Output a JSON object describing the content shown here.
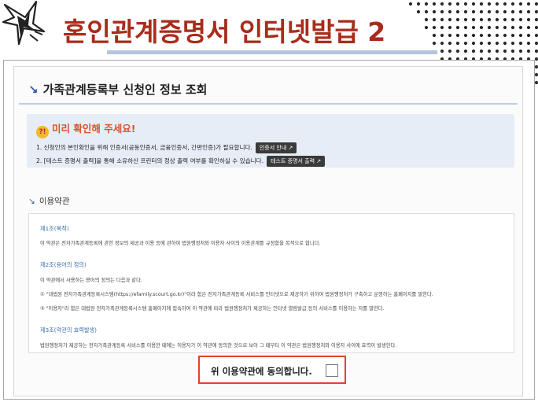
{
  "slide": {
    "title": "혼인관계증명서 인터넷발급 2"
  },
  "section": {
    "heading": "가족관계등록부 신청인 정보 조회",
    "bullet": "↘"
  },
  "notice": {
    "title": "미리 확인해 주세요!",
    "bulb_glyph": "?!",
    "line1": "1. 신청인의 본인확인을 위해 인증서(공동인증서, 금융인증서, 간편인증)가 필요합니다.",
    "line1_button": "인증서 안내 ↗",
    "line2": "2. [테스트 증명서 출력]을 통해 소유하신 프린터의 정상 출력 여부를 확인하실 수 있습니다.",
    "line2_button": "테스트 증명서 출력 ↗"
  },
  "terms": {
    "heading": "이용약관",
    "bullet": "↘",
    "articles": [
      {
        "title": "제1조(목적)",
        "lines": [
          "이 약관은 전자가족관계등록에 관한 정보의 제공과 이용 등에 관하여 법원행정처와 이용자 사이의 이용관계를 규정함을 목적으로 합니다."
        ]
      },
      {
        "title": "제2조(용어의 정의)",
        "lines": [
          "이 약관에서 사용하는 용어의 정의는 다음과 같다.",
          "① \"대법원 전자가족관계등록시스템(https://efamily.scourt.go.kr)\"이라 함은 전자가족관계등록 서비스를 인터넷으로 제공하기 위하여 법원행정처가 구축하고 운영하는 홈페이지를 말한다.",
          "② \"이용자\"라 함은 대법원 전자가족관계등록시스템 홈페이지에 접속하여 이 약관에 따라 법원행정처가 제공하는 인터넷 열람발급 등의 서비스를 이용하는 자를 말한다."
        ]
      },
      {
        "title": "제3조(약관의 효력발생)",
        "lines": [
          "법원행정처가 제공하는 전자가족관계등록 서비스를 이용한 때에는 이용자가 이 약관에 동의한 것으로 보아 그 때부터 이 약관은 법원행정처와 이용자 사이에 효력이 발생한다."
        ]
      }
    ]
  },
  "agree": {
    "label": "위 이용약관에 동의합니다."
  },
  "colors": {
    "title_red": "#a82c1c",
    "highlight_red": "#e0422c",
    "article_blue": "#3a6fb0",
    "notice_bg": "#e6edf6"
  }
}
